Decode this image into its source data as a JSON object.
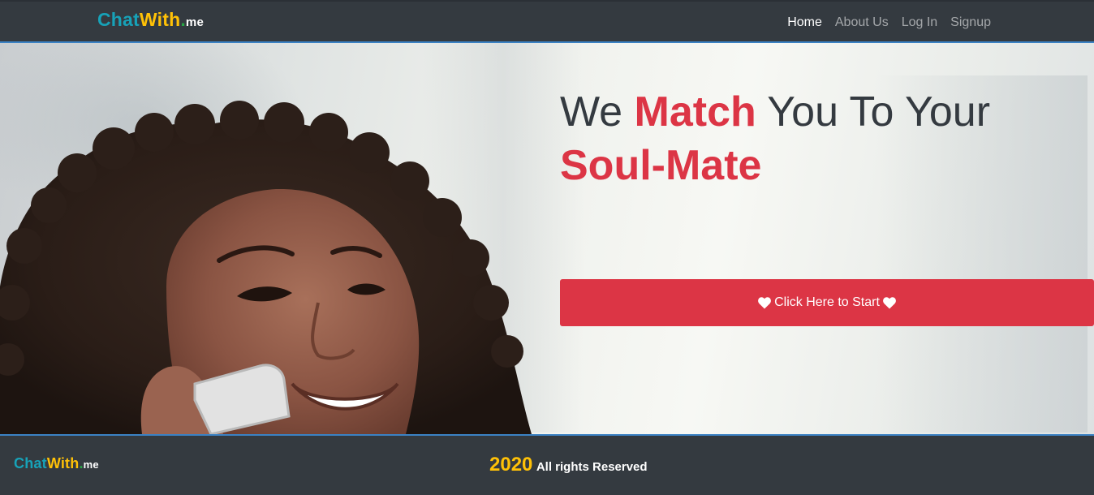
{
  "brand": {
    "part1": "Chat",
    "part2": "With",
    "dot": ".",
    "suffix": "me"
  },
  "nav": {
    "items": [
      {
        "label": "Home",
        "active": true
      },
      {
        "label": "About Us",
        "active": false
      },
      {
        "label": "Log In",
        "active": false
      },
      {
        "label": "Signup",
        "active": false
      }
    ]
  },
  "hero": {
    "headline_1": "We ",
    "headline_accent_1": "Match",
    "headline_2": " You To Your",
    "headline_accent_2": "Soul-Mate",
    "cta_label": "Click Here to Start",
    "cta_icon": "heart-icon"
  },
  "footer": {
    "brand": {
      "part1": "Chat",
      "part2": "With",
      "dot": ".",
      "suffix": "me"
    },
    "year": "2020",
    "rights": "All rights Reserved"
  },
  "colors": {
    "nav_bg": "#343a40",
    "danger": "#dc3545",
    "info": "#17a2b8",
    "warning": "#ffc107",
    "success": "#28a745"
  }
}
